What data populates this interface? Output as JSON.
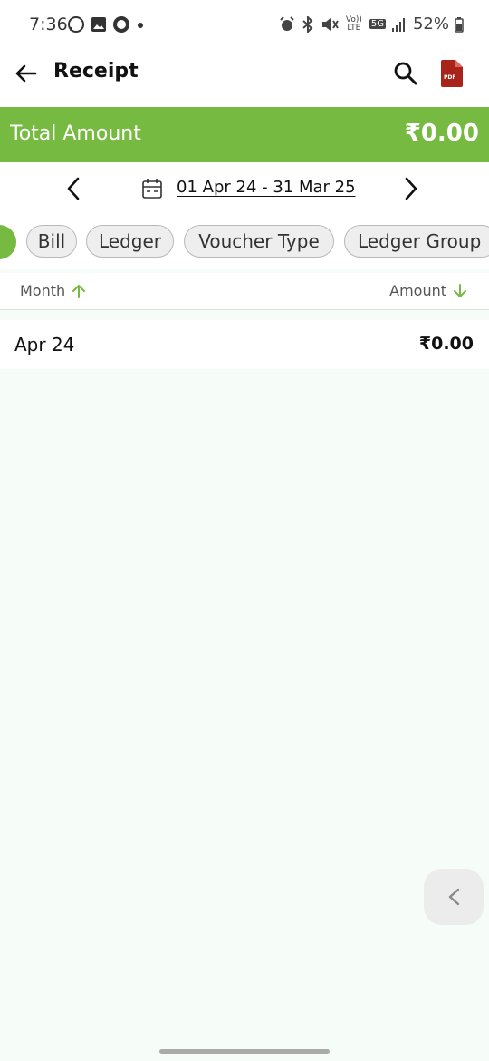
{
  "status_bar": {
    "time": "7:36",
    "battery": "52%",
    "network_label": "Vo)) LTE",
    "network_5g": "5G"
  },
  "app_bar": {
    "title": "Receipt",
    "icons": [
      "back-arrow-icon",
      "search-icon",
      "pdf-icon"
    ],
    "pdf_badge": "PDF",
    "pdf_color": "#a8231a"
  },
  "total": {
    "label": "Total Amount",
    "value": "₹0.00",
    "accent": "#76ba41"
  },
  "date_range": {
    "text": "01 Apr 24 - 31 Mar 25"
  },
  "filter_chips": [
    "Bill",
    "Ledger",
    "Voucher Type",
    "Ledger Group"
  ],
  "table": {
    "columns": [
      {
        "label": "Month",
        "sort": "ascending"
      },
      {
        "label": "Amount",
        "sort": "descending"
      }
    ],
    "rows": [
      {
        "month": "Apr 24",
        "amount": "₹0.00"
      }
    ]
  }
}
